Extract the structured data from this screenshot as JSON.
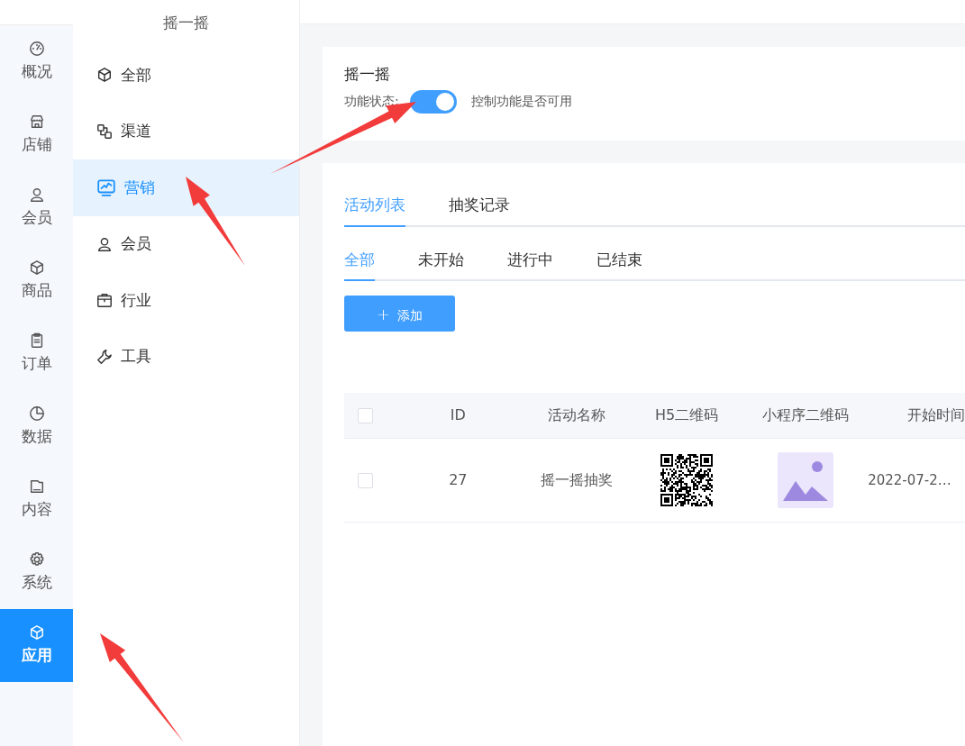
{
  "header": {
    "subtitle": "摇一摇"
  },
  "rail": {
    "items": [
      {
        "label": "概况",
        "selected": false
      },
      {
        "label": "店铺",
        "selected": false
      },
      {
        "label": "会员",
        "selected": false
      },
      {
        "label": "商品",
        "selected": false
      },
      {
        "label": "订单",
        "selected": false
      },
      {
        "label": "数据",
        "selected": false
      },
      {
        "label": "内容",
        "selected": false
      },
      {
        "label": "系统",
        "selected": false
      },
      {
        "label": "应用",
        "selected": true
      }
    ]
  },
  "submenu": {
    "items": [
      {
        "label": "全部",
        "selected": false
      },
      {
        "label": "渠道",
        "selected": false
      },
      {
        "label": "营销",
        "selected": true
      },
      {
        "label": "会员",
        "selected": false
      },
      {
        "label": "行业",
        "selected": false
      },
      {
        "label": "工具",
        "selected": false
      }
    ]
  },
  "feature": {
    "title": "摇一摇",
    "status_label": "功能状态:",
    "on": true,
    "hint": "控制功能是否可用"
  },
  "tabs": [
    {
      "label": "活动列表",
      "selected": true
    },
    {
      "label": "抽奖记录",
      "selected": false
    }
  ],
  "filters": [
    {
      "label": "全部",
      "selected": true
    },
    {
      "label": "未开始",
      "selected": false
    },
    {
      "label": "进行中",
      "selected": false
    },
    {
      "label": "已结束",
      "selected": false
    }
  ],
  "add_button": {
    "icon": "+",
    "label": "添加"
  },
  "table": {
    "select_all_checked": false,
    "columns": [
      "ID",
      "活动名称",
      "H5二维码",
      "小程序二维码",
      "开始时间"
    ],
    "rows": [
      {
        "checked": false,
        "id": "27",
        "name": "摇一摇抽奖",
        "start_time": "2022-07-2…"
      }
    ]
  }
}
